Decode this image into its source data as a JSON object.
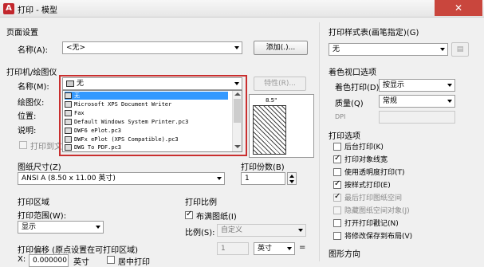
{
  "window": {
    "title": "打印 - 模型",
    "close": "✕"
  },
  "page_setup": {
    "group": "页面设置",
    "name_label": "名称(A):",
    "name_value": "<无>",
    "add_button": "添加(.)..."
  },
  "printer": {
    "group": "打印机/绘图仪",
    "name_label": "名称(M):",
    "name_value": "无",
    "properties_button": "特性(R)...",
    "plotter_label": "绘图仪:",
    "where_label": "位置:",
    "description_label": "说明:",
    "print_to_file_label": "打印到文",
    "dimension": "8.5\"",
    "dropdown_items": [
      "无",
      "Microsoft XPS Document Writer",
      "Fax",
      "Default Windows System Printer.pc3",
      "DWF6 ePlot.pc3",
      "DWFx ePlot (XPS Compatible).pc3",
      "DWG To PDF.pc3"
    ]
  },
  "paper": {
    "label": "图纸尺寸(Z)",
    "value": "ANSI A (8.50 x 11.00 英寸)"
  },
  "copies": {
    "label": "打印份数(B)",
    "value": "1"
  },
  "area": {
    "group": "打印区域",
    "range_label": "打印范围(W):",
    "range_value": "显示"
  },
  "scale": {
    "group": "打印比例",
    "fit_label": "布满图纸(I)",
    "scale_label": "比例(S):",
    "scale_value": "自定义",
    "num": "1",
    "unit": "英寸",
    "eq": "="
  },
  "offset": {
    "label": "打印偏移 (原点设置在可打印区域)",
    "x_value": "0.000000",
    "x_unit": "英寸",
    "center_label": "居中打印"
  },
  "style_table": {
    "label": "打印样式表(画笔指定)(G)",
    "value": "无"
  },
  "viewport": {
    "group": "着色视口选项",
    "shade_label": "着色打印(D)",
    "shade_value": "按显示",
    "quality_label": "质量(Q)",
    "quality_value": "常规",
    "dpi_label": "DPI"
  },
  "options": {
    "group": "打印选项",
    "items": [
      {
        "label": "后台打印(K)",
        "checked": false,
        "disabled": false
      },
      {
        "label": "打印对象线宽",
        "checked": true,
        "disabled": false
      },
      {
        "label": "使用透明度打印(T)",
        "checked": false,
        "disabled": false
      },
      {
        "label": "按样式打印(E)",
        "checked": true,
        "disabled": false
      },
      {
        "label": "最后打印图纸空间",
        "checked": true,
        "disabled": true
      },
      {
        "label": "隐藏图纸空间对象(J)",
        "checked": false,
        "disabled": true
      },
      {
        "label": "打开打印戳记(N)",
        "checked": false,
        "disabled": false
      },
      {
        "label": "将修改保存到布局(V)",
        "checked": false,
        "disabled": false
      }
    ]
  },
  "orientation": {
    "group": "图形方向"
  }
}
